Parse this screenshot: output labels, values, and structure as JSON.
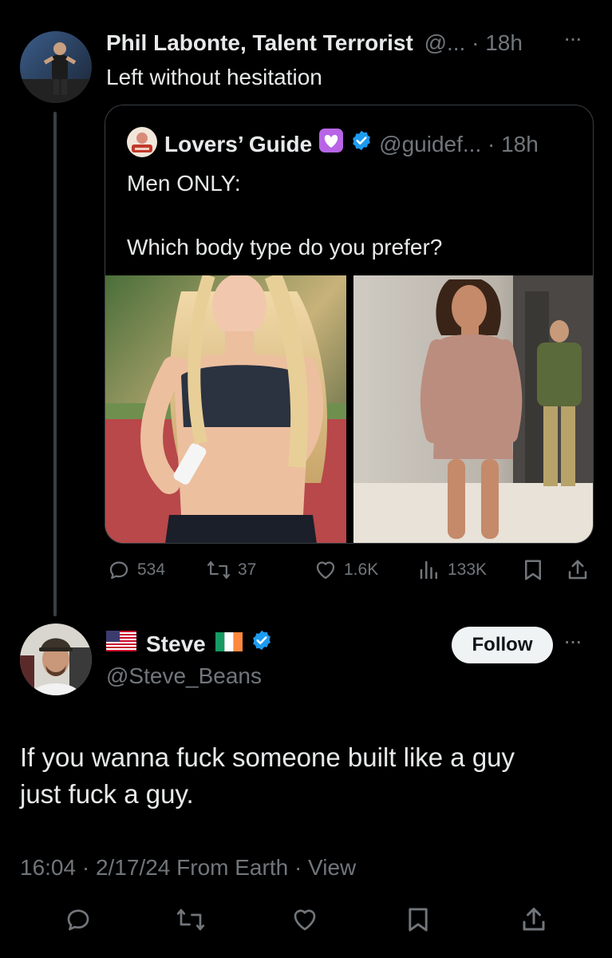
{
  "top_tweet": {
    "author_name": "Phil Labonte, Talent Terrorist",
    "handle_time": "@... · 18h",
    "more": "···",
    "text": "Left without hesitation"
  },
  "quoted_tweet": {
    "author_name": "Lovers’ Guide",
    "handle_time": "@guidef... · 18h",
    "text_line1": "Men ONLY:",
    "text_line2": "Which body type do you prefer?"
  },
  "actions": {
    "replies": "534",
    "retweets": "37",
    "likes": "1.6K",
    "views": "133K"
  },
  "reply_tweet": {
    "author_name": "Steve",
    "handle": "@Steve_Beans",
    "follow_label": "Follow",
    "more": "···",
    "text_line1": "If you wanna fuck someone built like a guy",
    "text_line2": "just fuck a guy.",
    "meta": "16:04 · 2/17/24 From Earth · View"
  },
  "colors": {
    "background": "#000000",
    "text": "#e7e9ea",
    "muted": "#71767b",
    "verified": "#1d9bf0",
    "heart_badge": "#b765e6",
    "border": "#3a3f44"
  }
}
